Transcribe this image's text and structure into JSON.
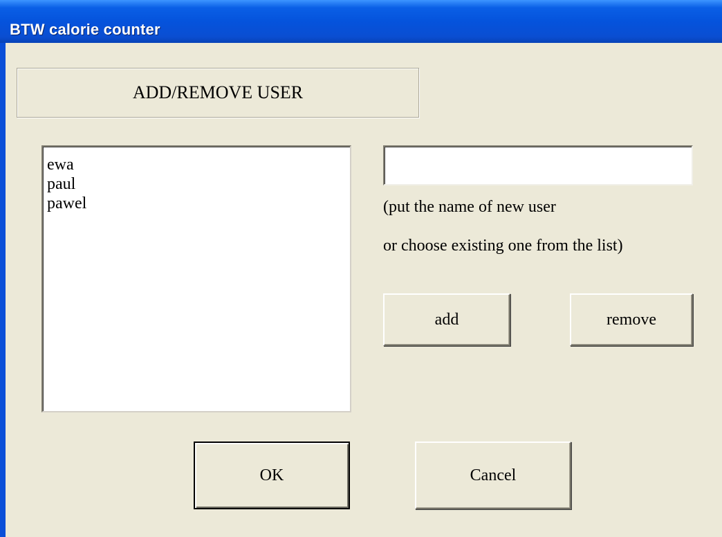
{
  "window": {
    "title": "BTW calorie counter"
  },
  "header": {
    "label": "ADD/REMOVE USER"
  },
  "users": {
    "items": [
      "ewa",
      "paul",
      "pawel"
    ]
  },
  "new_user": {
    "value": "",
    "hint_line1": "(put the name of new user",
    "hint_line2": "or choose existing one from the list)"
  },
  "actions": {
    "add_label": "add",
    "remove_label": "remove"
  },
  "dialog_buttons": {
    "ok_label": "OK",
    "cancel_label": "Cancel"
  },
  "colors": {
    "titlebar": "#0553dc",
    "dialog_background": "#ece9d8"
  }
}
